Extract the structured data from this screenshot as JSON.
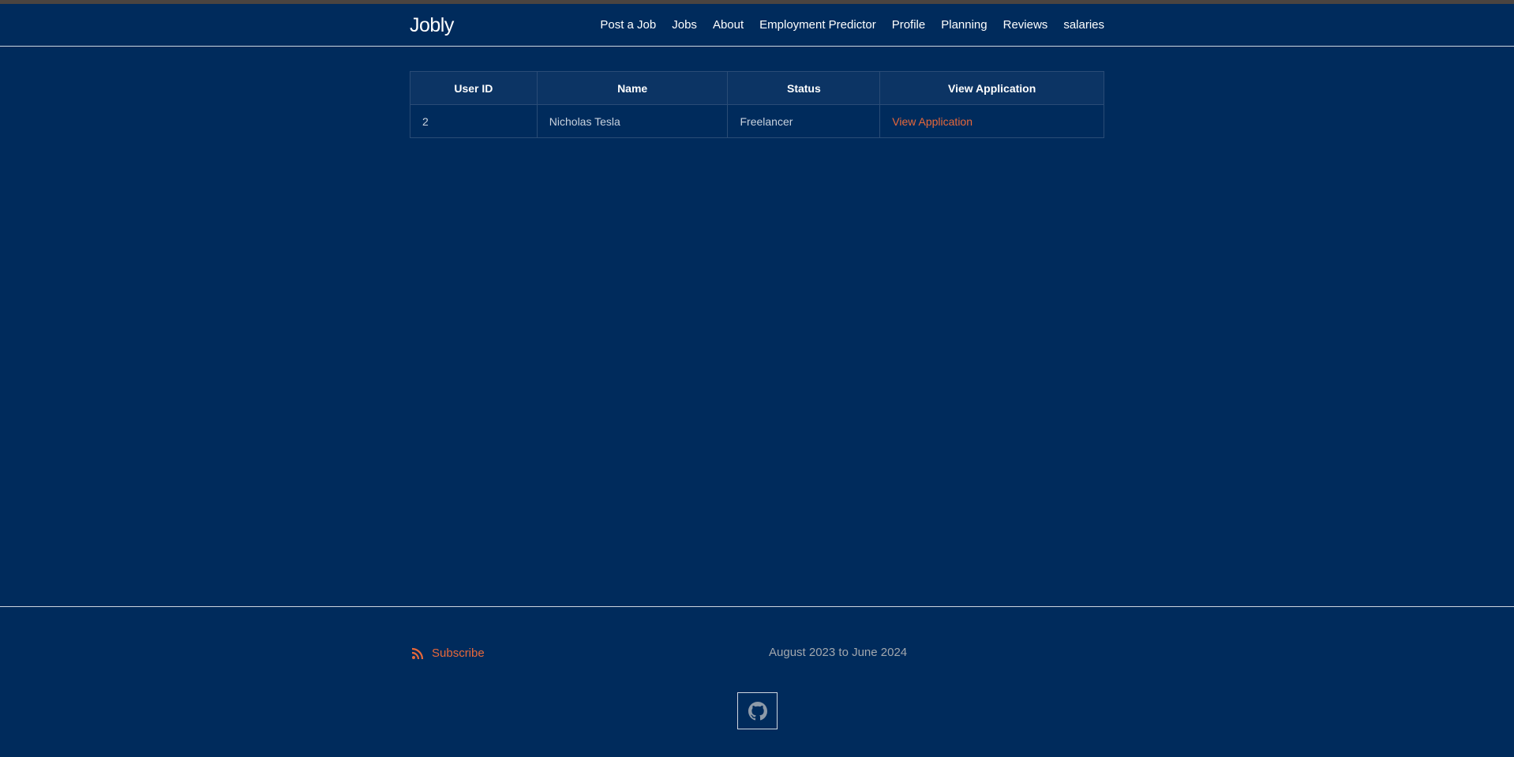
{
  "header": {
    "brand": "Jobly",
    "nav": [
      "Post a Job",
      "Jobs",
      "About",
      "Employment Predictor",
      "Profile",
      "Planning",
      "Reviews",
      "salaries"
    ]
  },
  "table": {
    "columns": [
      "User ID",
      "Name",
      "Status",
      "View Application"
    ],
    "rows": [
      {
        "user_id": "2",
        "name": "Nicholas Tesla",
        "status": "Freelancer",
        "link": "View Application"
      }
    ]
  },
  "footer": {
    "subscribe_label": "Subscribe",
    "dates": "August 2023 to June 2024",
    "icons": [
      "rss-icon",
      "github-icon"
    ]
  },
  "colors": {
    "background": "#002b5c",
    "accent": "#e8683a",
    "table_header": "#0c3464"
  }
}
